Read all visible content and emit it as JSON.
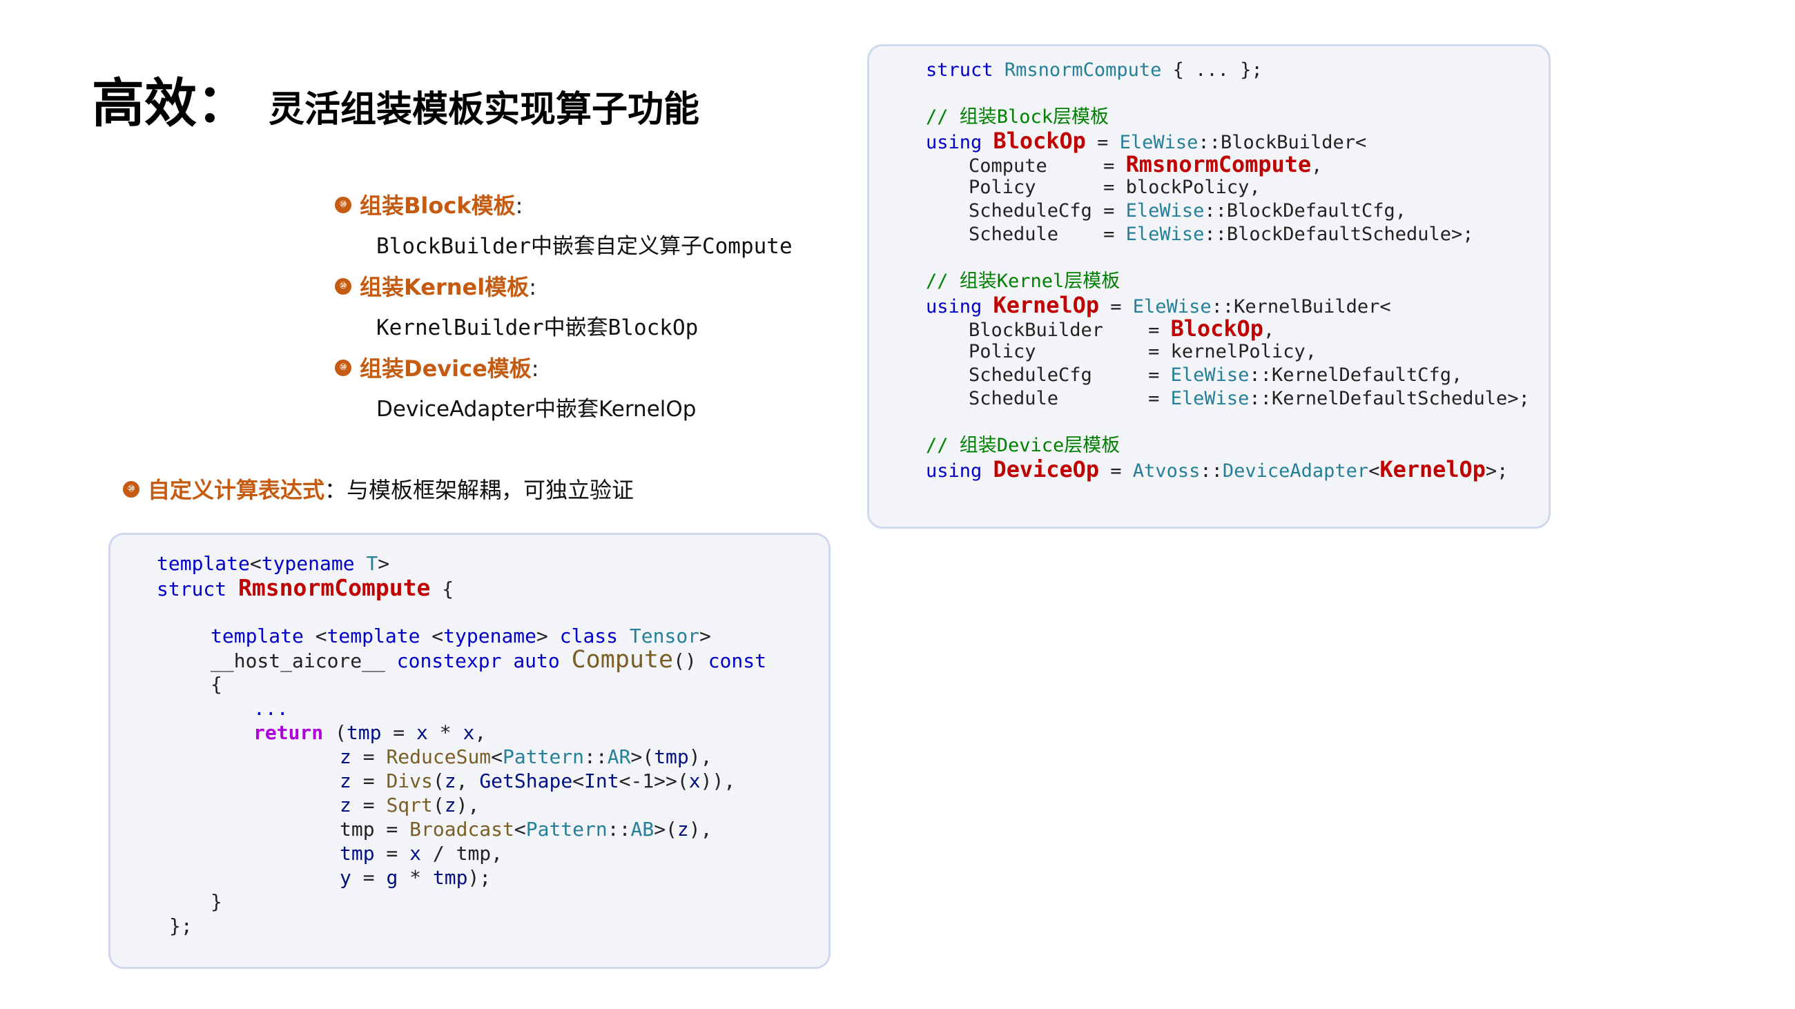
{
  "title": {
    "main": "高效：",
    "sub": "灵活组装模板实现算子功能"
  },
  "bullets": [
    {
      "icon": "circled-number-icon",
      "heading": "组装Block模板",
      "colon": ":",
      "desc": "BlockBuilder中嵌套自定义算子Compute",
      "mono": true
    },
    {
      "icon": "circled-number-icon",
      "heading": "组装Kernel模板",
      "colon": ":",
      "desc": "KernelBuilder中嵌套BlockOp",
      "mono": true
    },
    {
      "icon": "circled-number-icon",
      "heading": "组装Device模板",
      "colon": ":",
      "desc": "DeviceAdapter中嵌套KernelOp",
      "mono": false
    }
  ],
  "note": {
    "heading": "自定义计算表达式",
    "colon": "：",
    "text": "与模板框架解耦，可独立验证"
  },
  "colors": {
    "accent": "#c55a11",
    "keyword": "#0000c8",
    "type": "#267f99",
    "comment": "#008000",
    "highlight_name": "#c00000",
    "return_kw": "#af00db",
    "function": "#795e26",
    "variable": "#001080"
  },
  "right_code": {
    "struct_line": {
      "kw": "struct",
      "name": "RmsnormCompute",
      "rest": "{ ... };"
    },
    "block_comment": "// 组装Block层模板",
    "block_using": {
      "kw": "using",
      "name": "BlockOp",
      "eq": "=",
      "ns": "EleWise",
      "sep": "::",
      "builder": "BlockBuilder<"
    },
    "block_params": [
      {
        "key": "Compute",
        "eq": "=",
        "val": "RmsnormCompute",
        "suffix": ","
      },
      {
        "key": "Policy",
        "eq": "=",
        "val": "blockPolicy",
        "suffix": ","
      },
      {
        "key": "ScheduleCfg",
        "eq": "=",
        "ns": "EleWise",
        "sep": "::",
        "val": "BlockDefaultCfg",
        "suffix": ","
      },
      {
        "key": "Schedule",
        "eq": "=",
        "ns": "EleWise",
        "sep": "::",
        "val": "BlockDefaultSchedule",
        "suffix": ">;"
      }
    ],
    "kernel_comment": "// 组装Kernel层模板",
    "kernel_using": {
      "kw": "using",
      "name": "KernelOp",
      "eq": "=",
      "ns": "EleWise",
      "sep": "::",
      "builder": "KernelBuilder<"
    },
    "kernel_params": [
      {
        "key": "BlockBuilder",
        "eq": "=",
        "val": "BlockOp",
        "suffix": ","
      },
      {
        "key": "Policy",
        "eq": "=",
        "val": "kernelPolicy",
        "suffix": ","
      },
      {
        "key": "ScheduleCfg",
        "eq": "=",
        "ns": "EleWise",
        "sep": "::",
        "val": "KernelDefaultCfg",
        "suffix": ","
      },
      {
        "key": "Schedule",
        "eq": "=",
        "ns": "EleWise",
        "sep": "::",
        "val": "KernelDefaultSchedule",
        "suffix": ">;"
      }
    ],
    "device_comment": "// 组装Device层模板",
    "device_using": {
      "kw": "using",
      "name": "DeviceOp",
      "eq": "=",
      "ns": "Atvoss",
      "sep": "::",
      "adapter": "DeviceAdapter",
      "lt": "<",
      "arg": "KernelOp",
      "end": ">;"
    }
  },
  "left_code": {
    "template_line": {
      "kw": "template",
      "lt": "<",
      "kw2": "typename",
      "param": "T",
      "gt": ">"
    },
    "struct_line": {
      "kw": "struct",
      "name": "RmsnormCompute",
      "brace": "{"
    },
    "inner_template": {
      "kw": "template",
      "lt": "<",
      "kw2": "template",
      "lt2": "<",
      "kw3": "typename",
      "gt2": ">",
      "kw4": "class",
      "param": "Tensor",
      "gt": ">"
    },
    "compute_decl": {
      "macro": "__host_aicore__",
      "kw1": "constexpr",
      "kw2": "auto",
      "fn": "Compute",
      "parens": "()",
      "kw3": "const"
    },
    "open_brace": "{",
    "ellipsis": "...",
    "return_lines": [
      {
        "kw": "return",
        "a": "(",
        "b": "tmp",
        "c": " = ",
        "d": "x",
        "e": " * ",
        "f": "x",
        "g": ","
      },
      {
        "a": "z",
        "b": " = ",
        "fn": "ReduceSum",
        "c": "<",
        "ty": "Pattern",
        "d": "::",
        "ty2": "AR",
        "e": ">(",
        "v": "tmp",
        "f": "),"
      },
      {
        "a": "z",
        "b": " = ",
        "fn": "Divs",
        "c": "(",
        "v": "z",
        "d": ", ",
        "fn2": "GetShape",
        "e": "<",
        "ty": "Int",
        "f": "<-1>>(",
        "v2": "x",
        "g": ")),"
      },
      {
        "a": "z",
        "b": " = ",
        "fn": "Sqrt",
        "c": "(",
        "v": "z",
        "d": "),"
      },
      {
        "a": "tmp",
        "b": " = ",
        "fn": "Broadcast",
        "c": "<",
        "ty": "Pattern",
        "d": "::",
        "ty2": "AB",
        "e": ">(",
        "v": "z",
        "f": "),"
      },
      {
        "a": "tmp",
        "b": " = ",
        "v": "x",
        "c": " / ",
        "d": "tmp",
        "e": ","
      },
      {
        "a": "y",
        "b": " = ",
        "v": "g",
        "c": " * ",
        "v2": "tmp",
        "d": ");"
      }
    ],
    "close_fn": "}",
    "close_struct": "};"
  }
}
